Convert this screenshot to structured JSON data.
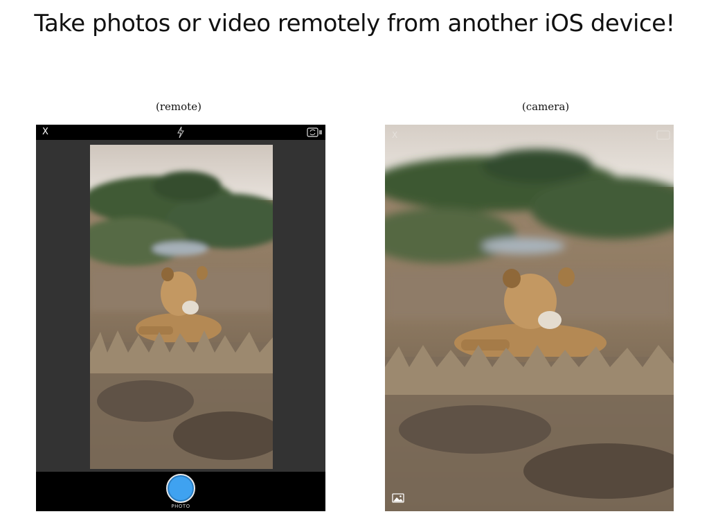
{
  "headline": "Take photos or video remotely from another iOS device!",
  "remote": {
    "caption": "(remote)",
    "close_label": "X",
    "icons": {
      "flash": "flash-icon",
      "flip": "camera-flip-icon",
      "shutter": "shutter-button"
    },
    "mode_label": "PHOTO"
  },
  "camera": {
    "caption": "(camera)",
    "close_label": "X",
    "icons": {
      "flip": "camera-flip-icon",
      "gallery": "gallery-icon"
    }
  },
  "colors": {
    "remote_panel": "#333333",
    "bars": "#000000",
    "shutter": "#3fa2f0"
  }
}
